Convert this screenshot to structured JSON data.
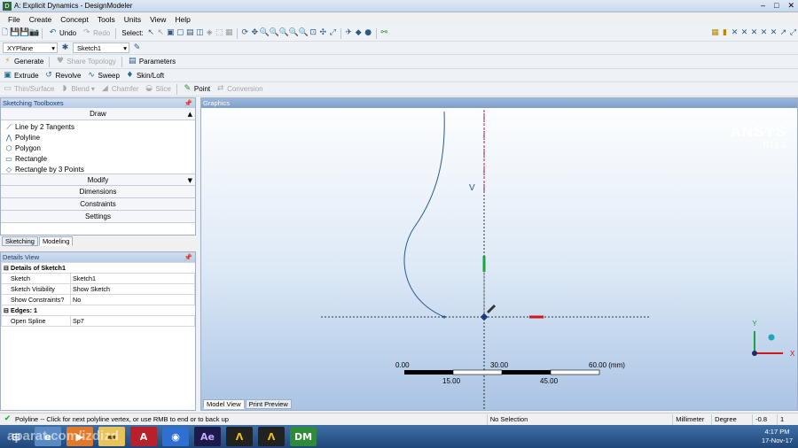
{
  "window": {
    "title": "A: Explicit Dynamics - DesignModeler",
    "app_icon": "DM"
  },
  "menu": [
    "File",
    "Create",
    "Concept",
    "Tools",
    "Units",
    "View",
    "Help"
  ],
  "toolbar1": {
    "undo_label": "Undo",
    "redo_label": "Redo",
    "select_label": "Select:"
  },
  "toolbar2": {
    "plane": "XYPlane",
    "sketch": "Sketch1"
  },
  "toolbar3": {
    "generate": "Generate",
    "share_topology": "Share Topology",
    "parameters": "Parameters"
  },
  "toolbar4": {
    "extrude": "Extrude",
    "revolve": "Revolve",
    "sweep": "Sweep",
    "skin_loft": "Skin/Loft"
  },
  "toolbar5": {
    "thin_surface": "Thin/Surface",
    "blend": "Blend",
    "chamfer": "Chamfer",
    "slice": "Slice",
    "point": "Point",
    "conversion": "Conversion"
  },
  "sketching_toolboxes": {
    "header": "Sketching Toolboxes",
    "draw_label": "Draw",
    "draw_items": [
      {
        "label": "Line by 2 Tangents",
        "icon": "line-tangent-icon"
      },
      {
        "label": "Polyline",
        "icon": "polyline-icon"
      },
      {
        "label": "Polygon",
        "icon": "polygon-icon"
      },
      {
        "label": "Rectangle",
        "icon": "rectangle-icon"
      },
      {
        "label": "Rectangle by 3 Points",
        "icon": "rectangle-3pt-icon"
      }
    ],
    "sections": [
      "Modify",
      "Dimensions",
      "Constraints",
      "Settings"
    ]
  },
  "mode_tabs": [
    "Sketching",
    "Modeling"
  ],
  "details_view": {
    "header": "Details View",
    "title": "Details of Sketch1",
    "rows": [
      {
        "key": "Sketch",
        "value": "Sketch1"
      },
      {
        "key": "Sketch Visibility",
        "value": "Show Sketch"
      },
      {
        "key": "Show Constraints?",
        "value": "No"
      }
    ],
    "edges_group": "Edges: 1",
    "edge_rows": [
      {
        "key": "Open Spline",
        "value": "Sp7"
      }
    ]
  },
  "graphics": {
    "header": "Graphics",
    "brand": "ANSYS",
    "version": "R16.2",
    "vertical_label": "V",
    "triad": {
      "y_label": "Y",
      "x_label": "X"
    },
    "scale_top": [
      "0.00",
      "30.00",
      "60.00 (mm)"
    ],
    "scale_bottom": [
      "15.00",
      "45.00"
    ],
    "view_tabs": [
      "Model View",
      "Print Preview"
    ]
  },
  "status": {
    "message": "Polyline -- Click for next polyline vertex, or use RMB to end or to back up",
    "selection": "No Selection",
    "units_length": "Millimeter",
    "units_angle": "Degree",
    "coord_1": "-0.8",
    "coord_2": "1"
  },
  "taskbar": {
    "watermark": "aparat.com/izdizd",
    "apps": [
      "start",
      "explorer",
      "media",
      "folder",
      "acrobat",
      "chrome",
      "after-effects",
      "ansys-workbench",
      "ansys",
      "designmodeler"
    ],
    "time": "4:17 PM",
    "date": "17-Nov-17"
  }
}
